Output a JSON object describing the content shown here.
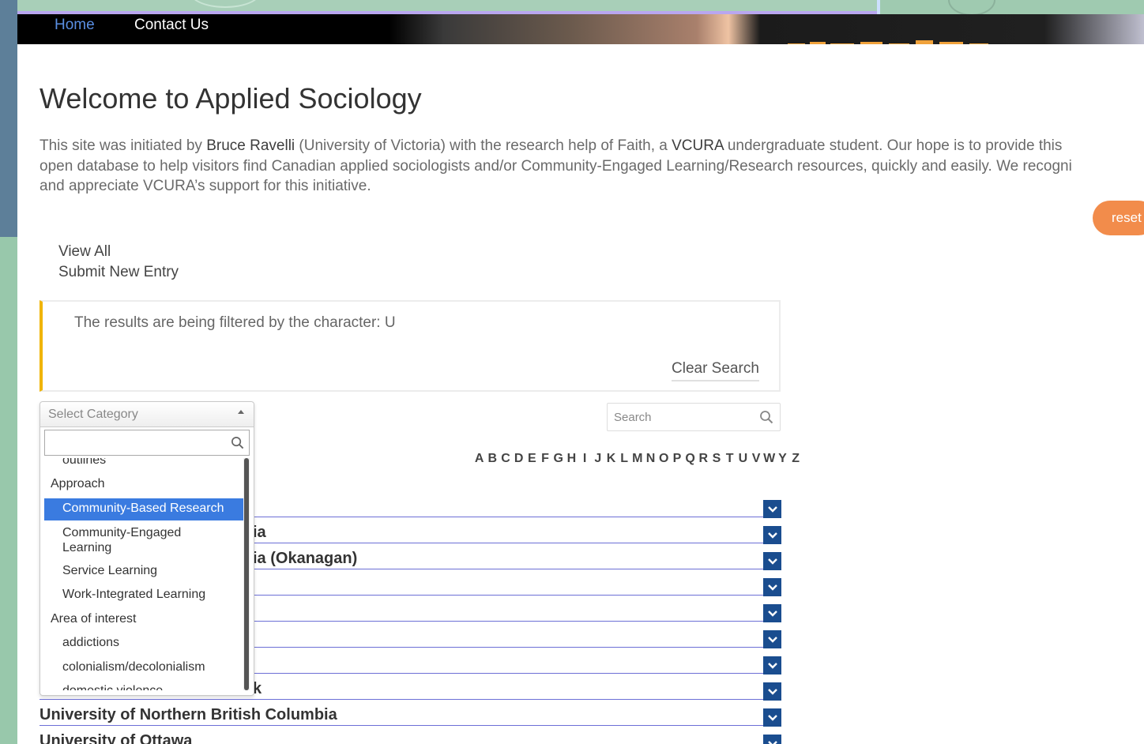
{
  "nav": {
    "home": "Home",
    "contact": "Contact Us"
  },
  "page": {
    "title": "Welcome to Applied Sociology",
    "intro_line1_a": "This site was initiated by ",
    "intro_name": "Bruce Ravelli",
    "intro_line1_b": " (University of Victoria) with the research help of Faith, a ",
    "intro_org": "VCURA",
    "intro_line1_c": " undergraduate student. Our hope is to provide this",
    "intro_line2": "open database to help visitors find Canadian applied sociologists and/or Community-Engaged Learning/Research resources, quickly and easily. We recogni",
    "intro_line3": "and appreciate VCURA’s support for this initiative.",
    "reset_label": "reset"
  },
  "links": {
    "view_all": "View All",
    "submit": "Submit New Entry"
  },
  "filter": {
    "message": "The results are being filtered by the character: U",
    "clear": "Clear Search"
  },
  "search": {
    "placeholder": "Search"
  },
  "alphabet": [
    "A",
    "B",
    "C",
    "D",
    "E",
    "F",
    "G",
    "H",
    "I",
    "J",
    "K",
    "L",
    "M",
    "N",
    "O",
    "P",
    "Q",
    "R",
    "S",
    "T",
    "U",
    "V",
    "W",
    "Y",
    "Z"
  ],
  "dropdown": {
    "placeholder": "Select Category",
    "items": [
      {
        "label": "outlines",
        "type": "child"
      },
      {
        "label": "Approach",
        "type": "group"
      },
      {
        "label": "Community-Based Research",
        "type": "child",
        "selected": true
      },
      {
        "label": "Community-Engaged\nLearning",
        "type": "child"
      },
      {
        "label": "Service Learning",
        "type": "child"
      },
      {
        "label": "Work-Integrated Learning",
        "type": "child"
      },
      {
        "label": "Area of interest",
        "type": "group"
      },
      {
        "label": "addictions",
        "type": "child"
      },
      {
        "label": "colonialism/decolonialism",
        "type": "child"
      },
      {
        "label": "domestic violence",
        "type": "child"
      }
    ]
  },
  "results": [
    {
      "label": ""
    },
    {
      "label": "ia"
    },
    {
      "label": "ia (Okanagan)"
    },
    {
      "label": ""
    },
    {
      "label": ""
    },
    {
      "label": ""
    },
    {
      "label": ""
    },
    {
      "label": "k"
    },
    {
      "label": "University of Northern British Columbia"
    },
    {
      "label": "University of Ottawa"
    }
  ],
  "colors": {
    "accent_blue": "#1a4d8f",
    "reset_orange": "#f28c4b",
    "filter_bar": "#f0b400",
    "selected_item": "#3a7be0"
  }
}
